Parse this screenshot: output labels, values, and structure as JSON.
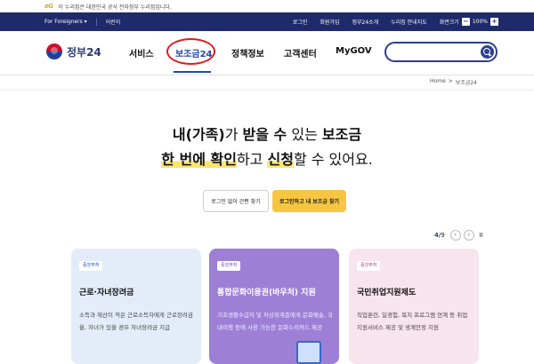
{
  "gov_notice": {
    "logo_text": "eG",
    "text": "이 누리집은 대한민국 공식 전자정부 누리집입니다."
  },
  "utility": {
    "left": [
      "For Foreigners ▾",
      "어린이"
    ],
    "right": [
      "로그인",
      "회원가입",
      "정부24소개",
      "누리집 안내지도",
      "화면크기"
    ],
    "zoom_minus": "−",
    "zoom_value": "100%",
    "zoom_plus": "+"
  },
  "header": {
    "logo_text": "정부24",
    "menu": [
      "서비스",
      "보조금24",
      "정책정보",
      "고객센터",
      "MyGOV"
    ],
    "active_menu_index": 1,
    "search_placeholder": ""
  },
  "breadcrumb": [
    "Home",
    ">",
    "보조금24"
  ],
  "hero": {
    "line1": {
      "a": "내(가족)",
      "b": "가 ",
      "c": "받을 수",
      "d": " 있는 ",
      "e": "보조금"
    },
    "line2": {
      "a": "한 번에 확인",
      "b": "하고 ",
      "c": "신청",
      "d": "할 수 있어요."
    }
  },
  "cta": {
    "guest": "로그인 없이 간편 찾기",
    "login": "로그인하고 내 보조금 찾기"
  },
  "pager": {
    "current": "4",
    "total": "/9",
    "prev": "‹",
    "next": "›",
    "pause": "II"
  },
  "cards": [
    {
      "badge": "중앙부처",
      "title": "근로·자녀장려금",
      "desc": "소득과 재산이 적은 근로소득자에게 근로장려금을, 자녀가 있을 경우 자녀장려금 지급"
    },
    {
      "badge": "중앙부처",
      "title": "통합문화이용권(바우처) 지원",
      "desc": "기초생활수급자 및 차상위계층에게 문화예술, 국내여행 등에 사용 가능한 문화누리카드 제공"
    },
    {
      "badge": "중앙부처",
      "title": "국민취업지원제도",
      "desc": "직업훈련, 일경험, 복지 프로그램 연계 등 취업지원서비스 제공 및 생계안정 지원"
    }
  ],
  "colors": {
    "navy": "#1f2a6b",
    "accent_blue": "#2248a8",
    "cta_yellow": "#f6c643",
    "annotation_red": "#e21b1b"
  }
}
